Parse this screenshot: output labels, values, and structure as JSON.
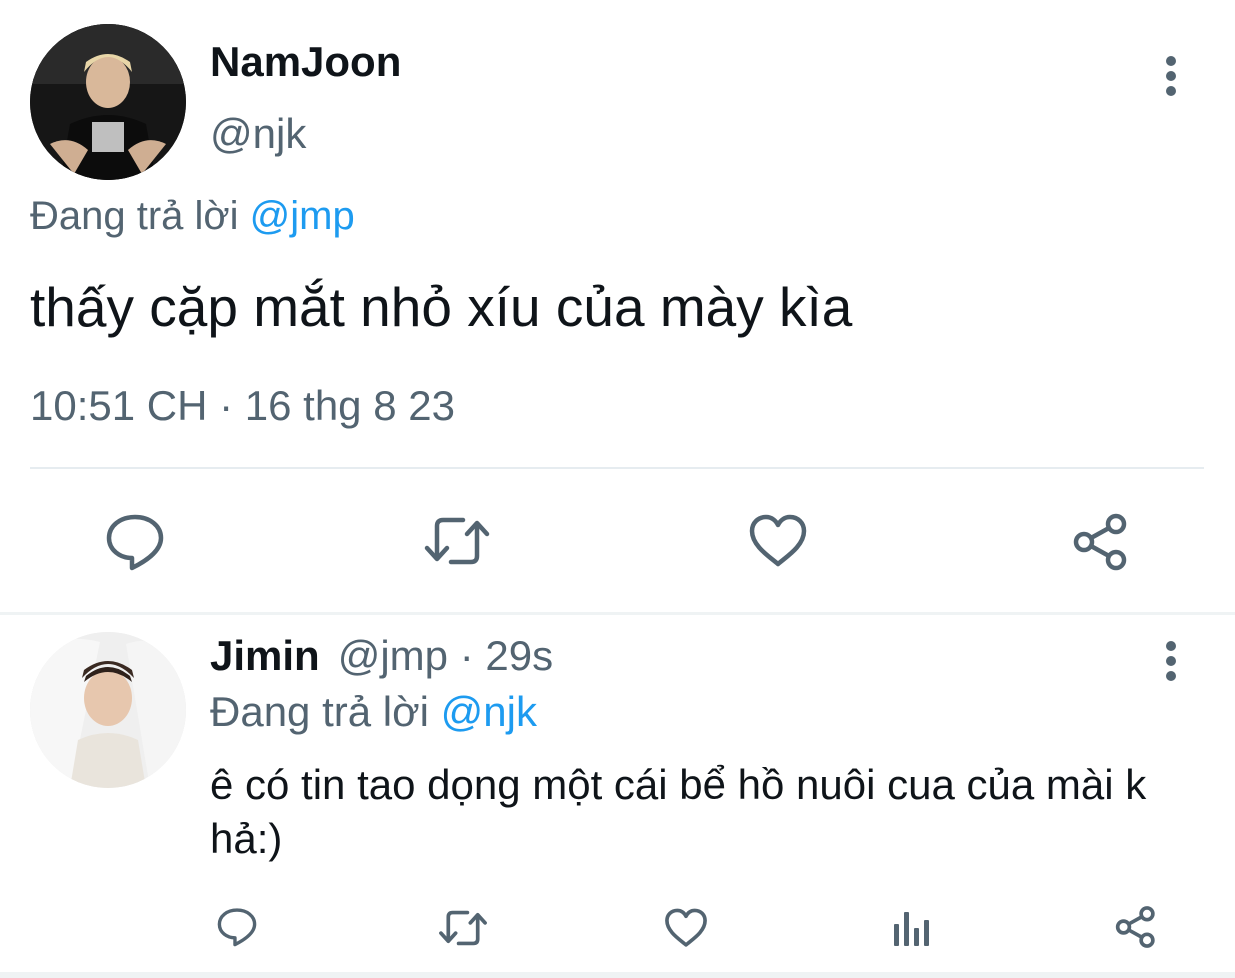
{
  "main_tweet": {
    "display_name": "NamJoon",
    "handle": "@njk",
    "replying_prefix": "Đang trả lời",
    "replying_to": "@jmp",
    "text": "thấy cặp mắt nhỏ xíu của mày kìa",
    "timestamp": "10:51 CH · 16 thg 8 23",
    "actions": [
      "reply-icon",
      "retweet-icon",
      "like-icon",
      "share-icon"
    ]
  },
  "reply_tweet": {
    "display_name": "Jimin",
    "handle": "@jmp",
    "separator": "·",
    "time_ago": "29s",
    "replying_prefix": "Đang trả lời",
    "replying_to": "@njk",
    "text": "ê có tin tao dọng một cái bể hồ nuôi cua của mài k hả:)",
    "actions": [
      "reply-icon",
      "retweet-icon",
      "like-icon",
      "analytics-icon",
      "share-icon"
    ]
  },
  "colors": {
    "primary_text": "#0f1419",
    "secondary_text": "#536471",
    "mention": "#1d9bf0",
    "divider": "#e6ecf0"
  }
}
